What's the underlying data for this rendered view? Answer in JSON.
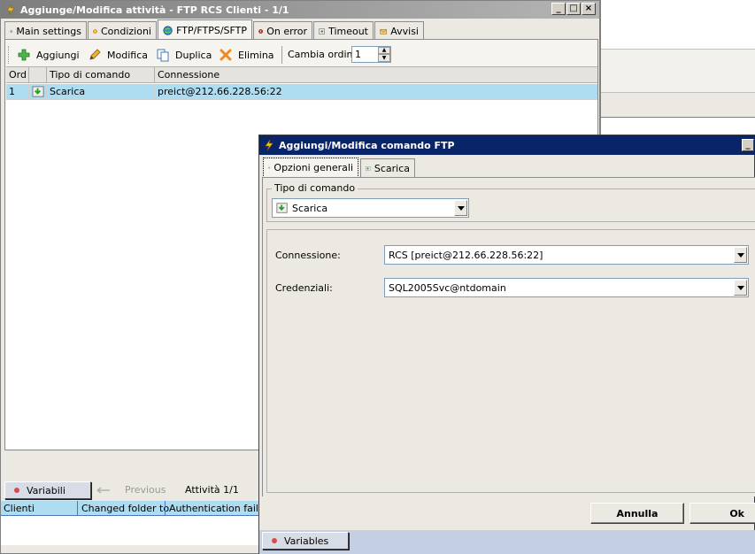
{
  "main_window": {
    "title": "Aggiunge/Modifica attività - FTP RCS Clienti - 1/1",
    "tabs": [
      {
        "label": "Main settings",
        "icon": "gear-icon"
      },
      {
        "label": "Condizioni",
        "icon": "question-icon"
      },
      {
        "label": "FTP/FTPS/SFTP",
        "icon": "globe-icon"
      },
      {
        "label": "On error",
        "icon": "error-icon"
      },
      {
        "label": "Timeout",
        "icon": "timeout-icon"
      },
      {
        "label": "Avvisi",
        "icon": "mail-icon"
      }
    ],
    "active_tab": 2,
    "toolbar": {
      "add": "Aggiungi",
      "edit": "Modifica",
      "duplicate": "Duplica",
      "delete": "Elimina",
      "order_label": "Cambia ordine",
      "order_value": "1"
    },
    "grid": {
      "columns": [
        "Ord",
        "",
        "Tipo di comando",
        "Connessione"
      ],
      "rows": [
        {
          "ord": "1",
          "type": "Scarica",
          "connection": "preict@212.66.228.56:22"
        }
      ]
    },
    "footer": {
      "variables": "Variabili",
      "previous": "Previous",
      "activity": "Attività 1/1"
    },
    "bottom_columns": [
      "Clienti",
      "Changed folder to",
      "Authentication failed"
    ]
  },
  "dialog": {
    "title": "Aggiungi/Modifica comando FTP",
    "tabs": [
      {
        "label": "Opzioni generali",
        "icon": "gear-icon"
      },
      {
        "label": "Scarica",
        "icon": "download-icon"
      }
    ],
    "group_label": "Tipo di comando",
    "command_type": "Scarica",
    "connection_label": "Connessione:",
    "connection_value": "RCS [preict@212.66.228.56:22]",
    "credentials_label": "Credenziali:",
    "credentials_value": "SQL2005Svc@ntdomain",
    "cancel": "Annulla",
    "ok": "Ok",
    "variables": "Variables"
  },
  "colors": {
    "title_active": "#0a246a",
    "title_inactive": "#808080",
    "selection": "#aedcf0"
  }
}
